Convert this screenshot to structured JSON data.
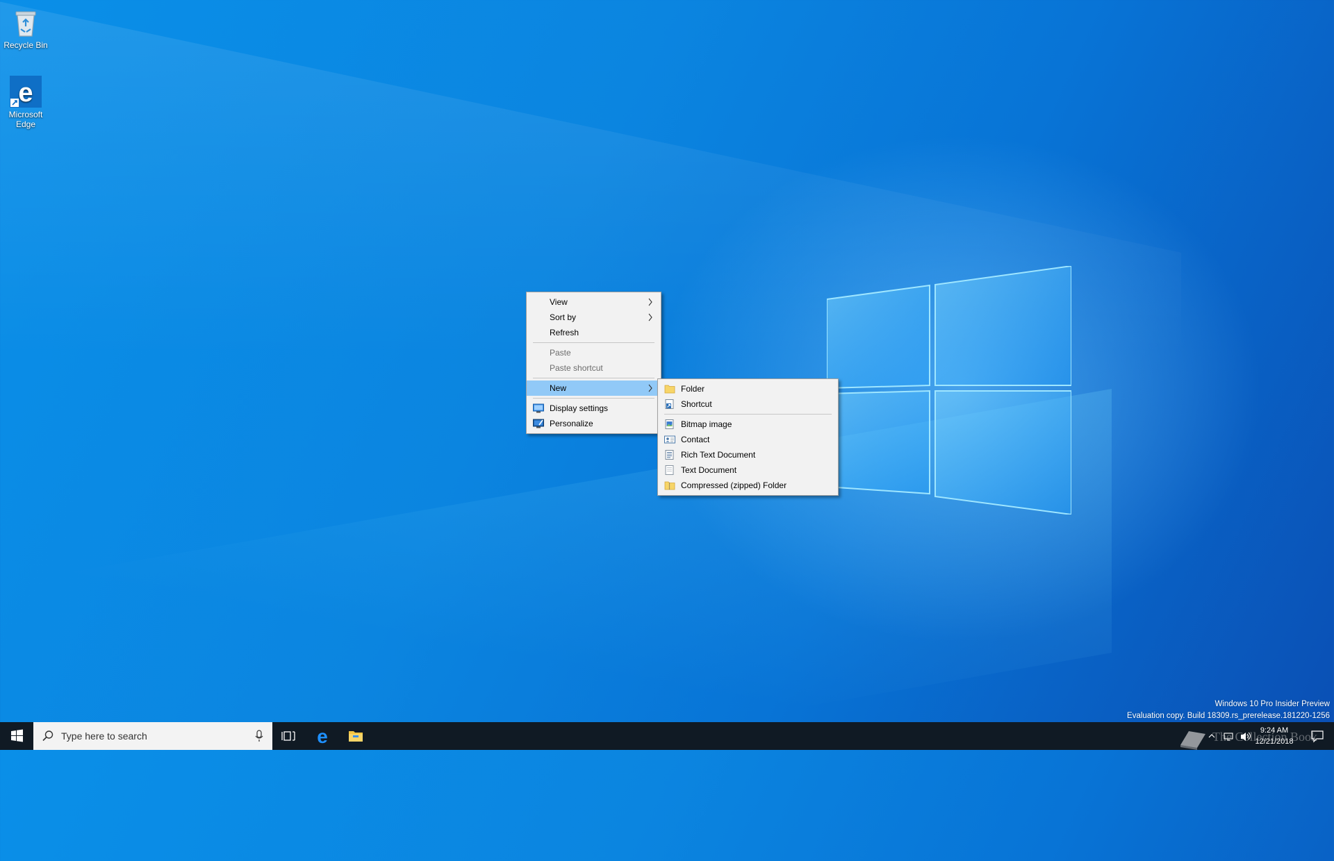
{
  "desktop": {
    "icons": [
      {
        "label": "Recycle Bin",
        "icon": "recycle-bin-icon"
      },
      {
        "label": "Microsoft Edge",
        "icon": "edge-icon"
      }
    ]
  },
  "context_menu": {
    "view": "View",
    "sort_by": "Sort by",
    "refresh": "Refresh",
    "paste": "Paste",
    "paste_shortcut": "Paste shortcut",
    "new": "New",
    "display_settings": "Display settings",
    "personalize": "Personalize"
  },
  "new_submenu": {
    "folder": "Folder",
    "shortcut": "Shortcut",
    "bitmap": "Bitmap image",
    "contact": "Contact",
    "rich_text": "Rich Text Document",
    "text_doc": "Text Document",
    "zip": "Compressed (zipped) Folder"
  },
  "taskbar": {
    "search_placeholder": "Type here to search",
    "time": "9:24 AM",
    "date": "12/21/2018"
  },
  "watermark": {
    "line1": "Windows 10 Pro Insider Preview",
    "line2": "Evaluation copy. Build 18309.rs_prerelease.181220-1256"
  },
  "overlay_brand": "The Collection Book",
  "colors": {
    "menu_bg": "#f2f2f2",
    "menu_highlight": "#91c9f7",
    "taskbar": "#101a24",
    "accent": "#0078d7"
  }
}
